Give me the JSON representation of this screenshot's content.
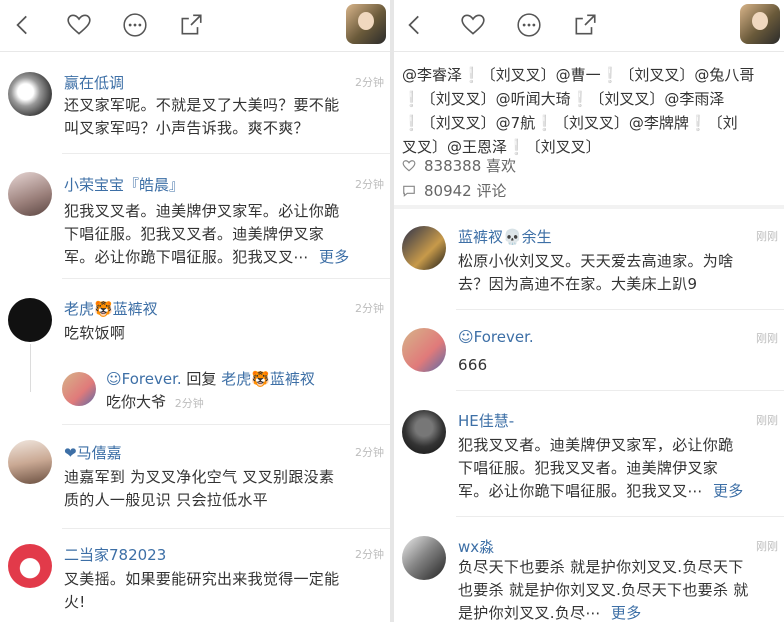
{
  "colors": {
    "link": "#3d6fa6",
    "time": "#bdbdbd",
    "divider": "#ececec"
  },
  "icons": [
    "back-icon",
    "heart-icon",
    "more-dots-icon",
    "share-icon"
  ],
  "left": {
    "comments": [
      {
        "name": "赢在低调",
        "time": "2分钟",
        "lines": [
          "还叉家军呢。不就是叉了大美吗？要不能",
          "叫叉家军吗？小声告诉我。爽不爽？"
        ]
      },
      {
        "name": "小荣宝宝『皓晨』",
        "time": "2分钟",
        "lines": [
          "犯我叉叉者。迪美牌伊叉家军。必让你跪",
          "下唱征服。犯我叉叉者。迪美牌伊叉家",
          "军。必让你跪下唱征服。犯我叉叉⋯"
        ],
        "more": "更多"
      },
      {
        "name": "老虎🐯蓝裤衩",
        "time": "2分钟",
        "lines": [
          "吃软饭啊"
        ],
        "reply": {
          "author": "☺Forever.",
          "verb": "回复",
          "target": "老虎🐯蓝裤衩",
          "text": "吃你大爷",
          "time": "2分钟"
        }
      },
      {
        "name": "❤马僖嘉",
        "time": "2分钟",
        "lines": [
          "迪嘉军到 为叉叉净化空气 叉叉别跟没素",
          "质的人一般见识 只会拉低水平"
        ]
      },
      {
        "name": "二当家782023",
        "time": "2分钟",
        "lines": [
          "叉美摇。如果要能研究出来我觉得一定能",
          "火!"
        ]
      }
    ]
  },
  "right": {
    "mentions": [
      "@李睿泽❕〔刘叉叉〕@曹一❕〔刘叉叉〕@兔八哥",
      "❕〔刘叉叉〕@听闻大琦❕〔刘叉叉〕@李雨泽",
      "❕〔刘叉叉〕@7航❕〔刘叉叉〕@李牌牌❕〔刘",
      "叉叉〕@王恩泽❕〔刘叉叉〕"
    ],
    "likes": "838388 喜欢",
    "comments_count": "80942 评论",
    "comments": [
      {
        "name": "蓝裤衩💀余生",
        "time": "刚刚",
        "lines": [
          "松原小伙刘叉叉。天天爱去高迪家。为啥",
          "去？因为高迪不在家。大美床上趴9"
        ]
      },
      {
        "name": "☺Forever.",
        "time": "刚刚",
        "lines": [
          "666"
        ]
      },
      {
        "name": "HE佳慧-",
        "time": "刚刚",
        "lines": [
          "犯我叉叉者。迪美牌伊叉家军，必让你跪",
          "下唱征服。犯我叉叉者。迪美牌伊叉家",
          "军。必让你跪下唱征服。犯我叉叉⋯"
        ],
        "more": "更多"
      },
      {
        "name": "wx淼",
        "time": "刚刚",
        "lines": [
          "负尽天下也要杀 就是护你刘叉叉.负尽天下",
          "也要杀 就是护你刘叉叉.负尽天下也要杀 就",
          "是护你刘叉叉.负尽⋯"
        ],
        "more": "更多"
      }
    ]
  }
}
